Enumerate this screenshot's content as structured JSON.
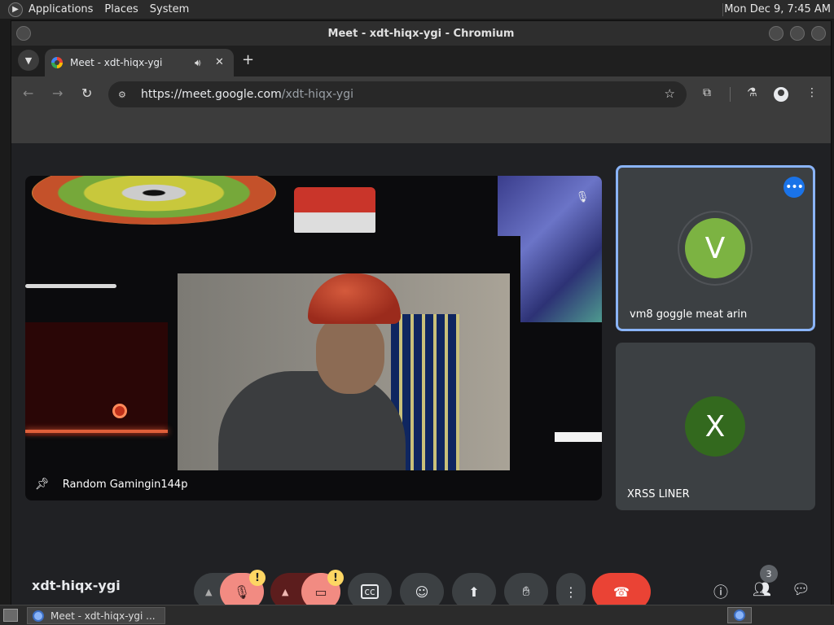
{
  "top_panel": {
    "menus": [
      "Applications",
      "Places",
      "System"
    ],
    "clock": "Mon Dec  9,  7:45 AM"
  },
  "window": {
    "title": "Meet - xdt-hiqx-ygi - Chromium"
  },
  "tabs": [
    {
      "title": "Meet - xdt-hiqx-ygi"
    }
  ],
  "omnibox": {
    "url_host": "https://meet.google.com",
    "url_path": "/xdt-hiqx-ygi"
  },
  "meeting": {
    "code": "xdt-hiqx-ygi",
    "main_tile_name": "Random Gamingin144p",
    "participants": [
      {
        "initial": "V",
        "name": "vm8 goggle meat arin",
        "color": "#7cb342"
      },
      {
        "initial": "X",
        "name": "XRSS LINER",
        "color": "#33691e"
      }
    ],
    "people_count": "3",
    "warning_symbol": "!"
  },
  "taskbar": {
    "task_label": "Meet - xdt-hiqx-ygi ..."
  },
  "icons": {
    "tab_menu": "chevron-down-icon",
    "speaker": "speaker-icon",
    "close": "close-icon",
    "new_tab": "plus-icon",
    "back": "arrow-left-icon",
    "forward": "arrow-right-icon",
    "reload": "reload-icon",
    "bookmark": "star-icon",
    "extensions": "puzzle-icon",
    "labs": "flask-icon",
    "profile": "person-icon",
    "menu": "more-vert-icon",
    "pin": "pin-icon",
    "mic_off": "mic-off-icon",
    "captions": "cc-icon",
    "emoji": "emoji-icon",
    "present": "present-icon",
    "raise_hand": "hand-icon",
    "end_call": "phone-hangup-icon",
    "info": "info-icon",
    "people": "people-icon",
    "chat": "chat-icon"
  },
  "colors": {
    "accent_blue": "#8ab4f8",
    "end_call_red": "#ea4335",
    "warning_yellow": "#fdd663",
    "mic_off_bg": "#f28b82"
  }
}
